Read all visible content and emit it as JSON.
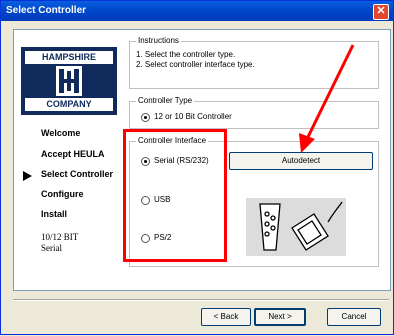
{
  "window": {
    "title": "Select Controller",
    "close_glyph": "✕"
  },
  "logo": {
    "top": "HAMPSHIRE",
    "bottom": "COMPANY"
  },
  "instructions": {
    "title": "Instructions",
    "line1": "1. Select the controller type.",
    "line2": "2. Select controller interface type."
  },
  "controller_type": {
    "title": "Controller Type",
    "option": "12 or 10 Bit Controller"
  },
  "controller_interface": {
    "title": "Controller Interface",
    "options": [
      "Serial (RS/232)",
      "USB",
      "PS/2"
    ],
    "selected": "Serial (RS/232)"
  },
  "autodetect_label": "Autodetect",
  "nav": {
    "items": [
      "Welcome",
      "Accept HEULA",
      "Select Controller",
      "Configure",
      "Install"
    ],
    "current": "Select Controller",
    "info_line1": "10/12 BIT",
    "info_line2": "Serial"
  },
  "buttons": {
    "back": "< Back",
    "next": "Next >",
    "cancel": "Cancel"
  },
  "icons": {
    "serial-port-icon": "serial",
    "serial-cable-icon": "cable",
    "current-step-arrow-icon": "arrow"
  },
  "colors": {
    "annotation": "#ff0000",
    "titlebar": "#0047c8"
  }
}
